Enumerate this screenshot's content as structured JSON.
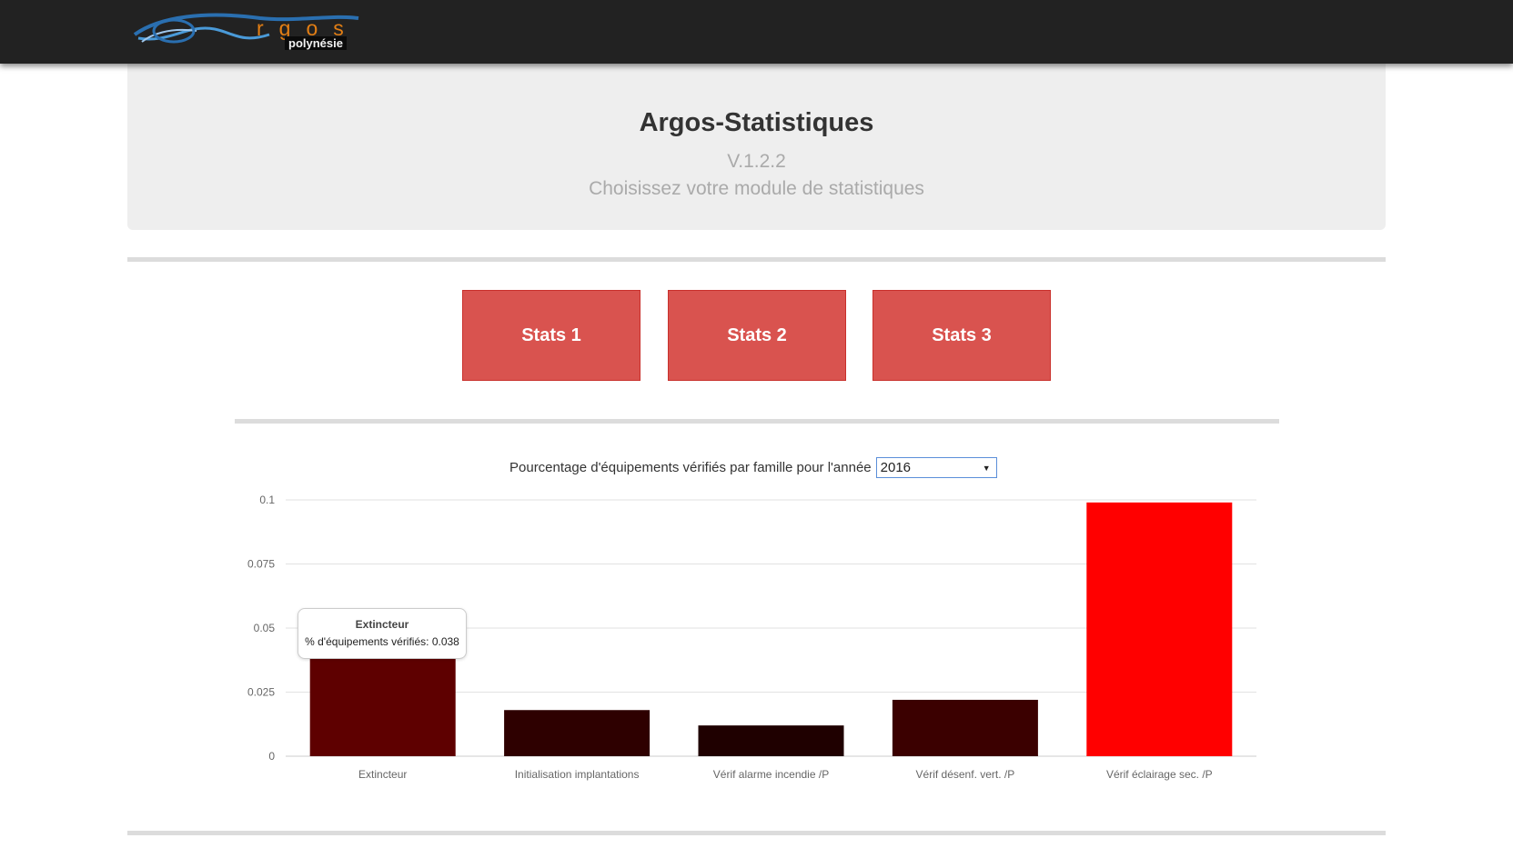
{
  "navbar": {
    "logo_text": "rgos",
    "logo_subtext": "polynésie",
    "logo_icon": "argos-swoosh-logo"
  },
  "jumbotron": {
    "title": "Argos-Statistiques",
    "version": "V.1.2.2",
    "subtitle": "Choisissez votre module de statistiques"
  },
  "modules": [
    {
      "label": "Stats 1"
    },
    {
      "label": "Stats 2"
    },
    {
      "label": "Stats 3"
    }
  ],
  "chart_header": {
    "label": "Pourcentage d'équipements vérifiés par famille pour l'année",
    "year_selected": "2016"
  },
  "colors": {
    "button": "#d9534f",
    "navbar": "#222222",
    "jumbotron": "#eeeeee"
  },
  "tooltip": {
    "title": "Extincteur",
    "body": "% d'équipements vérifiés: 0.038"
  },
  "chart_data": {
    "type": "bar",
    "categories": [
      "Extincteur",
      "Initialisation implantations",
      "Vérif alarme incendie /P",
      "Vérif désenf. vert. /P",
      "Vérif éclairage sec. /P"
    ],
    "series": [
      {
        "name": "% d'équipements vérifiés",
        "values": [
          0.038,
          0.018,
          0.012,
          0.022,
          0.099
        ]
      }
    ],
    "bar_colors": [
      "#5e0000",
      "#2e0000",
      "#1f0000",
      "#3b0000",
      "#ff0000"
    ],
    "y_ticks": [
      "0",
      "0.025",
      "0.05",
      "0.075",
      "0.1"
    ],
    "ylim": [
      0,
      0.1
    ],
    "grid": true,
    "legend": "none"
  }
}
